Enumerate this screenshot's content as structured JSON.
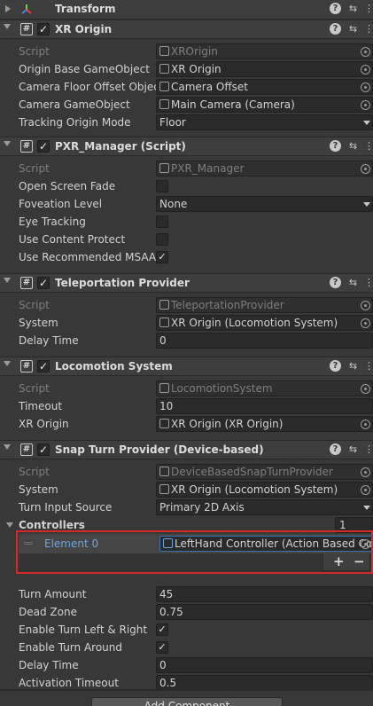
{
  "transform": {
    "title": "Transform"
  },
  "xr_origin": {
    "title": "XR Origin",
    "rows": [
      {
        "label": "Script",
        "value": "XROrigin"
      },
      {
        "label": "Origin Base GameObject",
        "value": "XR Origin"
      },
      {
        "label": "Camera Floor Offset Object",
        "value": "Camera Offset"
      },
      {
        "label": "Camera GameObject",
        "value": "Main Camera (Camera)"
      },
      {
        "label": "Tracking Origin Mode",
        "value": "Floor"
      }
    ]
  },
  "pxr_manager": {
    "title": "PXR_Manager (Script)",
    "rows": [
      {
        "label": "Script",
        "value": "PXR_Manager"
      },
      {
        "label": "Open Screen Fade",
        "checked": false
      },
      {
        "label": "Foveation Level",
        "value": "None"
      },
      {
        "label": "Eye Tracking",
        "checked": false
      },
      {
        "label": "Use Content Protect",
        "checked": false
      },
      {
        "label": "Use Recommended MSAA",
        "checked": true
      }
    ]
  },
  "teleportation": {
    "title": "Teleportation Provider",
    "rows": [
      {
        "label": "Script",
        "value": "TeleportationProvider"
      },
      {
        "label": "System",
        "value": "XR Origin (Locomotion System)"
      },
      {
        "label": "Delay Time",
        "value": "0"
      }
    ]
  },
  "locomotion": {
    "title": "Locomotion System",
    "rows": [
      {
        "label": "Script",
        "value": "LocomotionSystem"
      },
      {
        "label": "Timeout",
        "value": "10"
      },
      {
        "label": "XR Origin",
        "value": "XR Origin (XR Origin)"
      }
    ]
  },
  "snap_turn": {
    "title": "Snap Turn Provider (Device-based)",
    "rows": [
      {
        "label": "Script",
        "value": "DeviceBasedSnapTurnProvider"
      },
      {
        "label": "System",
        "value": "XR Origin (Locomotion System)"
      },
      {
        "label": "Turn Input Source",
        "value": "Primary 2D Axis"
      }
    ],
    "controllers": {
      "label": "Controllers",
      "size": "1",
      "element_label": "Element 0",
      "element_value": "LeftHand Controller (Action Based Co",
      "plus": "+",
      "minus": "−"
    },
    "rows2": [
      {
        "label": "Turn Amount",
        "value": "45"
      },
      {
        "label": "Dead Zone",
        "value": "0.75"
      },
      {
        "label": "Enable Turn Left & Right",
        "checked": true
      },
      {
        "label": "Enable Turn Around",
        "checked": true
      },
      {
        "label": "Delay Time",
        "value": "0"
      },
      {
        "label": "Activation Timeout",
        "value": "0.5"
      }
    ]
  },
  "add_component": "Add Component",
  "colors": {
    "highlight_border": "#d6282b",
    "element_label": "#6fa4dc"
  }
}
